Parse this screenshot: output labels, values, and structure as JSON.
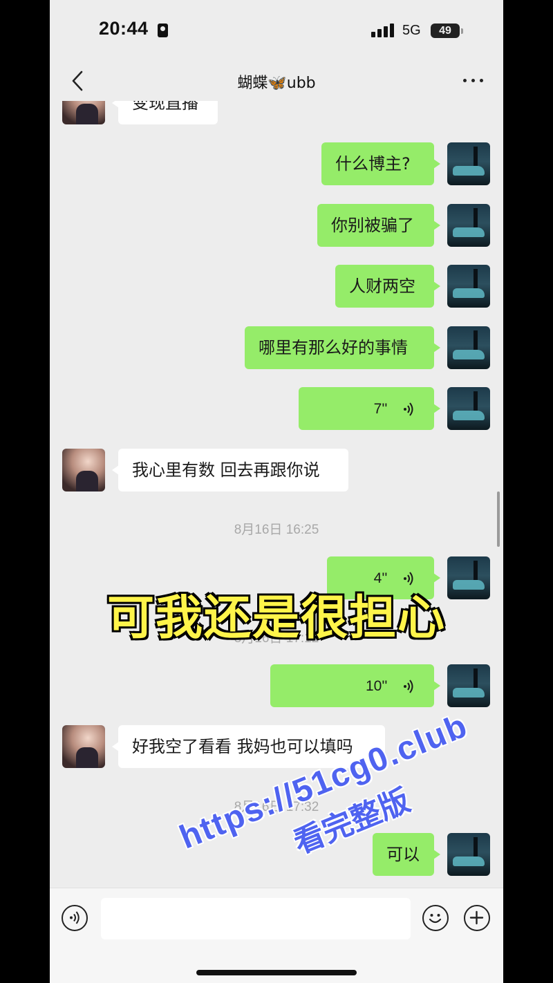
{
  "status_bar": {
    "time": "20:44",
    "network": "5G",
    "battery": "49"
  },
  "header": {
    "title": "蝴蝶🦋ubb",
    "back_icon": "chevron-left-icon",
    "more_icon": "more-dots-icon"
  },
  "messages": [
    {
      "id": "m0",
      "side": "theirs",
      "type": "text",
      "text": "变现直播"
    },
    {
      "id": "m1",
      "side": "mine",
      "type": "text",
      "text": "什么博主?"
    },
    {
      "id": "m2",
      "side": "mine",
      "type": "text",
      "text": "你别被骗了"
    },
    {
      "id": "m3",
      "side": "mine",
      "type": "text",
      "text": "人财两空"
    },
    {
      "id": "m4",
      "side": "mine",
      "type": "text",
      "text": "哪里有那么好的事情"
    },
    {
      "id": "m5",
      "side": "mine",
      "type": "voice",
      "duration": "7''"
    },
    {
      "id": "m6",
      "side": "theirs",
      "type": "text",
      "text": "我心里有数 回去再跟你说"
    },
    {
      "id": "t1",
      "type": "timestamp",
      "text": "8月16日 16:25"
    },
    {
      "id": "m7",
      "side": "mine",
      "type": "voice",
      "duration": "4''"
    },
    {
      "id": "t2",
      "type": "timestamp",
      "text": "8月16日 17:12"
    },
    {
      "id": "m8",
      "side": "mine",
      "type": "voice",
      "duration": "10''"
    },
    {
      "id": "m9",
      "side": "theirs",
      "type": "text",
      "text": "好我空了看看 我妈也可以填吗"
    },
    {
      "id": "t3",
      "type": "timestamp",
      "text": "8月16日 17:32"
    },
    {
      "id": "m10",
      "side": "mine",
      "type": "text",
      "text": "可以"
    }
  ],
  "overlay": {
    "caption": "可我还是很担心",
    "caption_color": "#fff44a",
    "watermark_url": "https://51cg0.club",
    "watermark_text": "看完整版",
    "watermark_color": "#4f63f0"
  },
  "input_bar": {
    "voice_icon": "voice-toggle-icon",
    "emoji_icon": "emoji-icon",
    "plus_icon": "plus-icon",
    "input_value": ""
  },
  "colors": {
    "bubble_mine": "#95ec69",
    "bubble_theirs": "#ffffff",
    "background": "#ededed"
  }
}
